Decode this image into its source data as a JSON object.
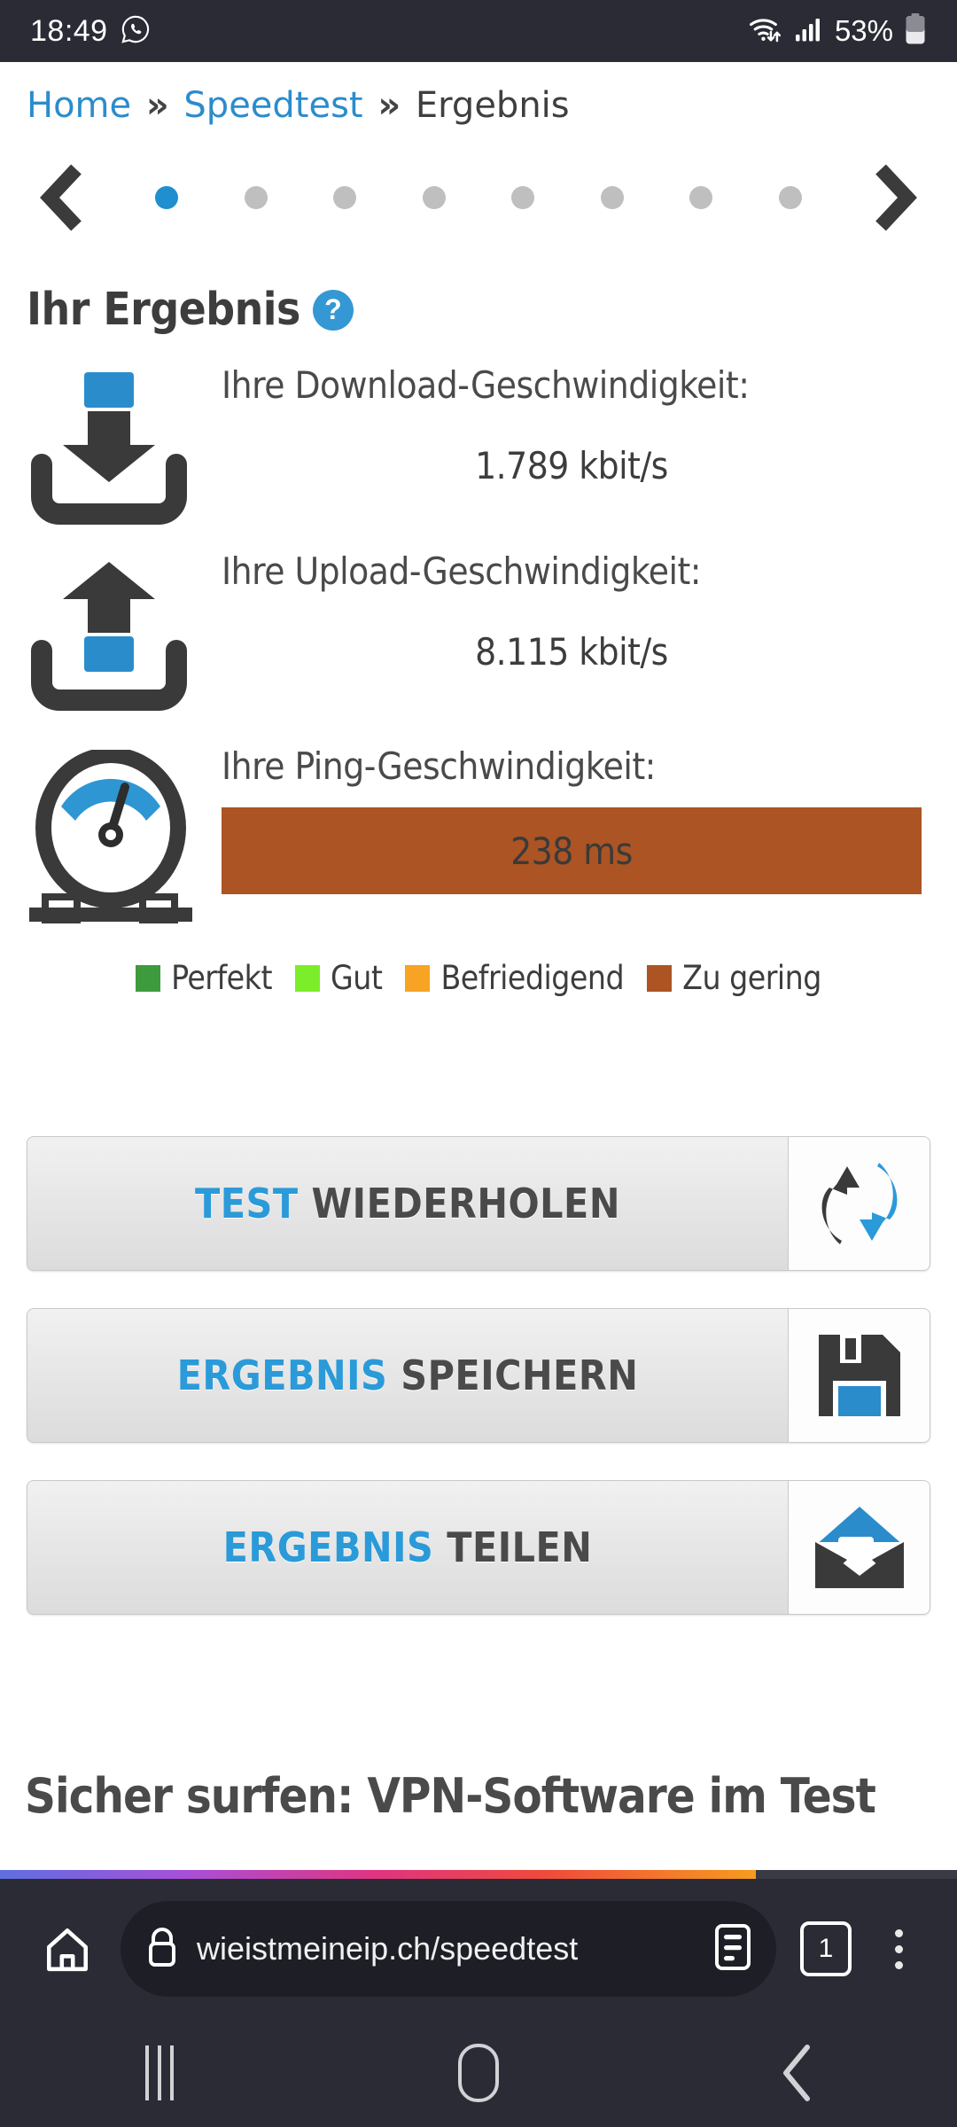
{
  "status_bar": {
    "time": "18:49",
    "whatsapp_icon": "whatsapp-icon",
    "wifi_icon": "wifi-icon",
    "signal_icon": "cellular-signal-icon",
    "battery_percent": "53%",
    "battery_icon": "battery-icon"
  },
  "breadcrumb": {
    "home": "Home",
    "sep1": "»",
    "speedtest": "Speedtest",
    "sep2": "»",
    "current": "Ergebnis"
  },
  "pager": {
    "prev_icon": "chevron-left-icon",
    "next_icon": "chevron-right-icon",
    "total_dots": 8,
    "active_index": 0,
    "active_color": "#1f8fd0",
    "inactive_color": "#bfbfbf"
  },
  "result": {
    "heading": "Ihr Ergebnis",
    "help_glyph": "?",
    "accent_color": "#2b8ccc",
    "metrics": [
      {
        "icon": "download-icon",
        "label": "Ihre Download-Geschwindigkeit:",
        "value": "1.789 kbit/s"
      },
      {
        "icon": "upload-icon",
        "label": "Ihre Upload-Geschwindigkeit:",
        "value": "8.115 kbit/s"
      },
      {
        "icon": "ping-gauge-icon",
        "label": "Ihre Ping-Geschwindigkeit:",
        "value": "238 ms",
        "bar_color": "#ac5423"
      }
    ],
    "legend": [
      {
        "label": "Perfekt",
        "color": "#3d9b3d"
      },
      {
        "label": "Gut",
        "color": "#7ced2a"
      },
      {
        "label": "Befriedigend",
        "color": "#f7a324"
      },
      {
        "label": "Zu gering",
        "color": "#ac5423"
      }
    ]
  },
  "actions": [
    {
      "accent": "TEST",
      "rest": "WIEDERHOLEN",
      "icon": "refresh-arrows-icon"
    },
    {
      "accent": "ERGEBNIS",
      "rest": "SPEICHERN",
      "icon": "floppy-disk-icon"
    },
    {
      "accent": "ERGEBNIS",
      "rest": "TEILEN",
      "icon": "share-envelope-icon"
    }
  ],
  "article": {
    "heading": "Sicher surfen: VPN-Software im Test"
  },
  "browser": {
    "home_icon": "home-icon",
    "lock_icon": "lock-icon",
    "url": "wieistmeineip.ch/speedtest",
    "reader_icon": "reader-mode-icon",
    "tab_count": "1",
    "menu_icon": "overflow-menu-icon"
  },
  "navbar": {
    "recents_icon": "recents-icon",
    "home_icon": "home-nav-icon",
    "back_icon": "back-icon"
  }
}
